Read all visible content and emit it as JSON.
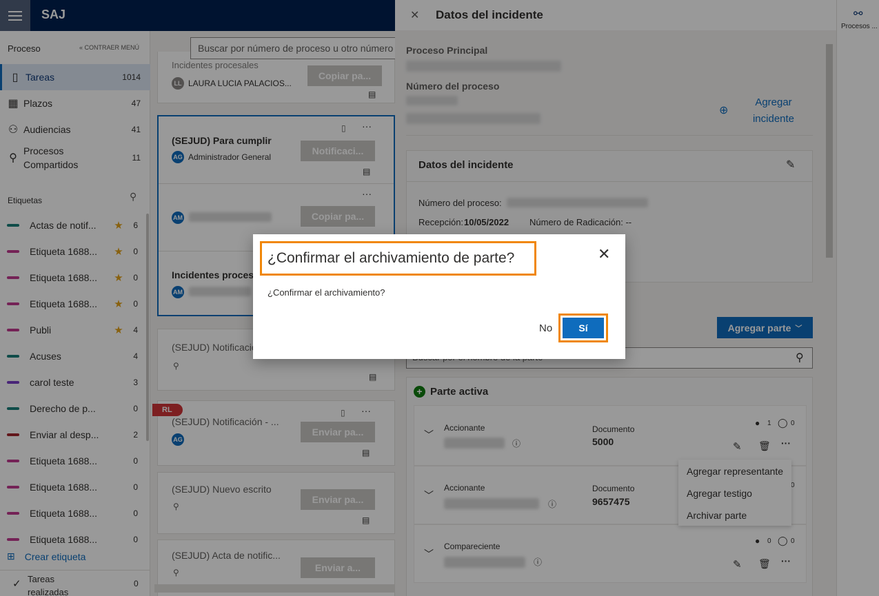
{
  "app": {
    "brand": "SAJ"
  },
  "sidebar": {
    "header": "Proceso",
    "collapse": "« CONTRAER MENÚ",
    "nav": [
      {
        "label": "Tareas",
        "count": "1014",
        "icon": "tasks-icon"
      },
      {
        "label": "Plazos",
        "count": "47",
        "icon": "calendar-icon"
      },
      {
        "label": "Audiencias",
        "count": "41",
        "icon": "people-icon"
      },
      {
        "label": "Procesos Compartidos",
        "count": "11",
        "icon": "share-person-icon"
      }
    ],
    "labels_header": "Etiquetas",
    "tags": [
      {
        "label": "Actas de notif...",
        "count": "6",
        "color": "#1a7f7a",
        "star": true
      },
      {
        "label": "Etiqueta 1688...",
        "count": "0",
        "color": "#c2398f",
        "star": true
      },
      {
        "label": "Etiqueta 1688...",
        "count": "0",
        "color": "#c2398f",
        "star": true
      },
      {
        "label": "Etiqueta 1688...",
        "count": "0",
        "color": "#c2398f",
        "star": true
      },
      {
        "label": "Publi",
        "count": "4",
        "color": "#c2398f",
        "star": true
      },
      {
        "label": "Acuses",
        "count": "4",
        "color": "#1a7f7a",
        "star": false
      },
      {
        "label": "carol teste",
        "count": "3",
        "color": "#7b3ec8",
        "star": false
      },
      {
        "label": "Derecho de p...",
        "count": "0",
        "color": "#1a7f7a",
        "star": false
      },
      {
        "label": "Enviar al desp...",
        "count": "2",
        "color": "#a4262c",
        "star": false
      },
      {
        "label": "Etiqueta 1688...",
        "count": "0",
        "color": "#c2398f",
        "star": false
      },
      {
        "label": "Etiqueta 1688...",
        "count": "0",
        "color": "#c2398f",
        "star": false
      },
      {
        "label": "Etiqueta 1688...",
        "count": "0",
        "color": "#c2398f",
        "star": false
      },
      {
        "label": "Etiqueta 1688...",
        "count": "0",
        "color": "#c2398f",
        "star": false
      }
    ],
    "create_label": "Crear etiqueta",
    "done_label": "Tareas realizadas",
    "done_count": "0"
  },
  "search": {
    "placeholder": "Buscar por número de proceso u otro número"
  },
  "cards": {
    "c0_title": "Incidentes procesales",
    "c0_user": "LAURA LUCIA PALACIOS...",
    "c0_initials": "LL",
    "c0_btn": "Copiar pa...",
    "c1_title": "(SEJUD) Para cumplir",
    "c1_user": "Administrador General",
    "c1_initials": "AG",
    "c1_btn": "Notificaci...",
    "c2_initials": "AM",
    "c2_btn": "Copiar pa...",
    "c3_title": "Incidentes procesa",
    "c3_initials": "AM",
    "c4_title": "(SEJUD) Notificació",
    "c5_badge": "RL",
    "c5_title": "(SEJUD) Notificación - ...",
    "c5_initials": "AG",
    "c5_btn": "Enviar pa...",
    "c6_title": "(SEJUD) Nuevo escrito",
    "c6_btn": "Enviar pa...",
    "c7_title": "(SEJUD) Acta de notific...",
    "c7_btn": "Enviar a..."
  },
  "panel": {
    "title": "Datos del incidente",
    "principal_label": "Proceso Principal",
    "number_label": "Número del proceso",
    "add_incident": "Agregar incidente",
    "section_title": "Datos del incidente",
    "proc_num_label": "Número del proceso:",
    "reception_label": "Recepción:",
    "reception_value": "10/05/2022",
    "radication": "Número de Radicación: --",
    "add_party": "Agregar parte",
    "party_search": "Buscar por el nombre de la parte",
    "active_party": "Parte activa",
    "parties": [
      {
        "role": "Accionante",
        "doc_label": "Documento",
        "doc": "5000",
        "people": "1",
        "comments": "0"
      },
      {
        "role": "Accionante",
        "doc_label": "Documento",
        "doc": "9657475",
        "people": "",
        "comments": "0"
      },
      {
        "role": "Compareciente",
        "doc_label": "",
        "doc": "",
        "people": "0",
        "comments": "0"
      }
    ]
  },
  "menu": {
    "items": [
      "Agregar representante",
      "Agregar testigo",
      "Archivar parte"
    ]
  },
  "rstrip": {
    "label": "Procesos ..."
  },
  "dialog": {
    "title": "¿Confirmar el archivamiento de parte?",
    "message": "¿Confirmar el archivamiento?",
    "no": "No",
    "yes": "Sí"
  },
  "colors": {
    "brand": "#002050",
    "accent": "#0f6cbd",
    "highlight": "#f0870a"
  }
}
